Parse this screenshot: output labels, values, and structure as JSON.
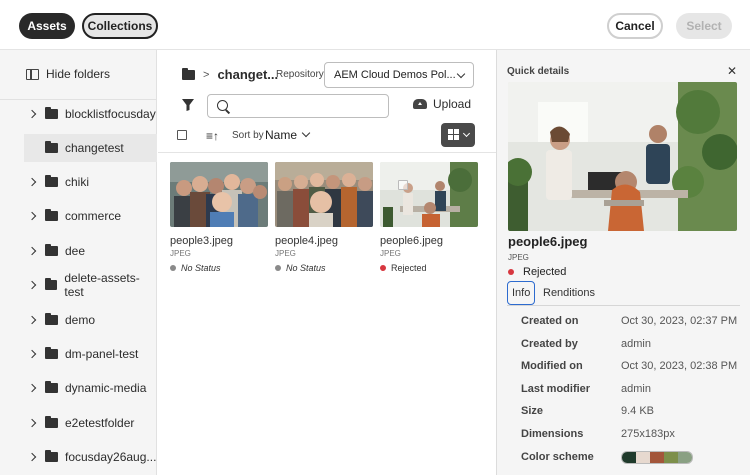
{
  "topbar": {
    "assets_label": "Assets",
    "collections_label": "Collections",
    "cancel_label": "Cancel",
    "select_label": "Select"
  },
  "sidebar": {
    "hide_folders_label": "Hide folders",
    "items": [
      {
        "label": "blocklistfocusday",
        "expandable": true
      },
      {
        "label": "changetest",
        "expandable": false
      },
      {
        "label": "chiki",
        "expandable": true
      },
      {
        "label": "commerce",
        "expandable": true
      },
      {
        "label": "dee",
        "expandable": true
      },
      {
        "label": "delete-assets-test",
        "expandable": true
      },
      {
        "label": "demo",
        "expandable": true
      },
      {
        "label": "dm-panel-test",
        "expandable": true
      },
      {
        "label": "dynamic-media",
        "expandable": true
      },
      {
        "label": "e2etestfolder",
        "expandable": true
      },
      {
        "label": "focusday26aug..."
      }
    ]
  },
  "main": {
    "breadcrumb": "changet...",
    "repository_label": "Repository",
    "repository_value": "AEM Cloud Demos Pol...",
    "search_placeholder": "",
    "upload_label": "Upload",
    "sort_by_label": "Sort by",
    "sort_value": "Name",
    "sort_order_icon": "sort-ascending-icon",
    "cards": [
      {
        "name": "people3.jpeg",
        "type": "JPEG",
        "status": "No Status",
        "status_color": "#8a8a8a"
      },
      {
        "name": "people4.jpeg",
        "type": "JPEG",
        "status": "No Status",
        "status_color": "#8a8a8a"
      },
      {
        "name": "people6.jpeg",
        "type": "JPEG",
        "status": "Rejected",
        "status_color": "#d7373f"
      }
    ]
  },
  "quick_details": {
    "title": "Quick details",
    "name": "people6.jpeg",
    "type": "JPEG",
    "status": "Rejected",
    "status_color": "#d7373f",
    "tabs": [
      "Info",
      "Renditions"
    ],
    "fields": [
      {
        "key": "Created on",
        "value": "Oct 30, 2023, 02:37 PM"
      },
      {
        "key": "Created by",
        "value": "admin"
      },
      {
        "key": "Modified on",
        "value": "Oct 30, 2023, 02:38 PM"
      },
      {
        "key": "Last modifier",
        "value": "admin"
      },
      {
        "key": "Size",
        "value": "9.4 KB"
      },
      {
        "key": "Dimensions",
        "value": "275x183px"
      }
    ],
    "color_scheme_label": "Color scheme",
    "color_scheme": [
      "#1f3a2b",
      "#e7d9cf",
      "#a3563a",
      "#7d8f4a",
      "#8aa083"
    ]
  }
}
